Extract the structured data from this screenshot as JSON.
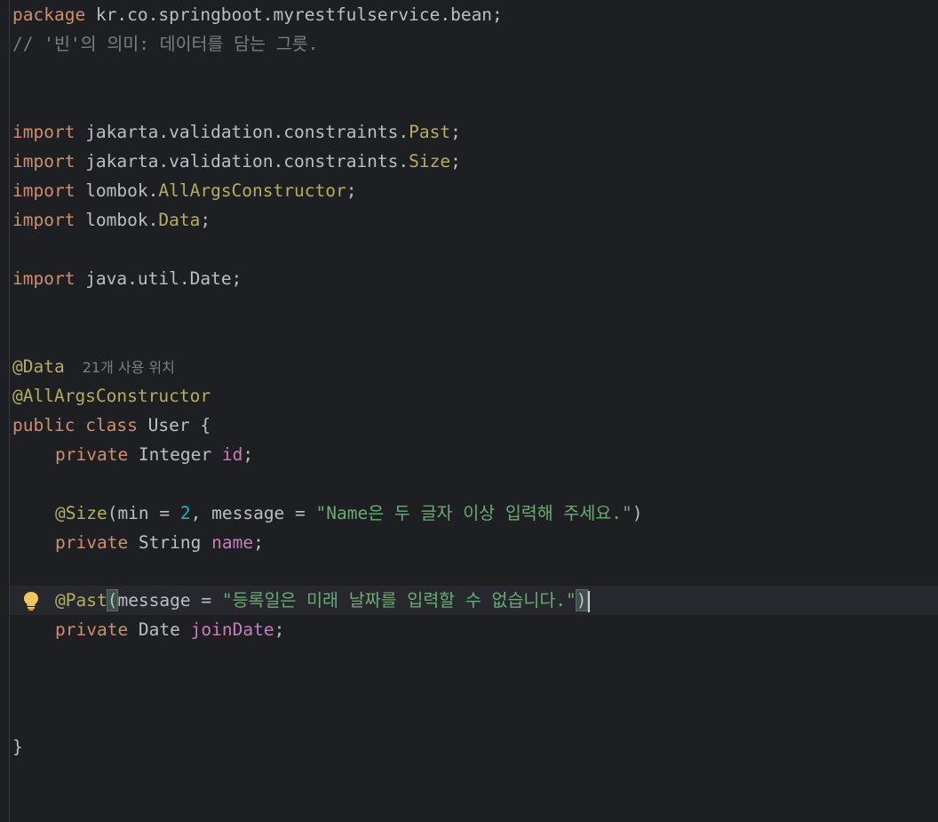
{
  "editor": {
    "language": "java",
    "colors": {
      "background": "#1e1f22",
      "keyword": "#cf8e6d",
      "annotation": "#b3ae60",
      "field": "#c77dbb",
      "string": "#6aab73",
      "number": "#2aacb8",
      "comment": "#7a7e85",
      "text": "#bcbec4"
    },
    "code": {
      "l1_kw": "package",
      "l1_rest": " kr.co.springboot.myrestfulservice.bean;",
      "l2_comment": "// '빈'의 의미: 데이터를 담는 그릇.",
      "import_kw": "import",
      "l5_pkg": " jakarta.validation.constraints.",
      "l5_cls": "Past",
      "l6_pkg": " jakarta.validation.constraints.",
      "l6_cls": "Size",
      "l7_pkg": " lombok.",
      "l7_cls": "AllArgsConstructor",
      "l8_pkg": " lombok.",
      "l8_cls": "Data",
      "semi": ";",
      "l10_rest": " java.util.Date;",
      "l13_ann": "@Data",
      "l13_hint": "21개 사용 위치",
      "l14_ann": "@AllArgsConstructor",
      "public_kw": "public",
      "class_kw": " class",
      "class_name": " User {",
      "private_kw": "private",
      "l16_type": " Integer ",
      "l16_field": "id",
      "l18_ann": "@Size",
      "l18_open": "(min = ",
      "l18_num": "2",
      "l18_mid": ", message = ",
      "l18_str": "\"Name은 두 글자 이상 입력해 주세요.\"",
      "l18_close": ")",
      "l19_type": " String ",
      "l19_field": "name",
      "l21_ann": "@Past",
      "l21_open": "(",
      "l21_mid": "message = ",
      "l21_str": "\"등록일은 미래 날짜를 입력할 수 없습니다.\"",
      "l21_close": ")",
      "l22_type": " Date ",
      "l22_field": "joinDate",
      "close_brace": "}"
    },
    "icons": {
      "intention": "lightbulb-icon"
    }
  }
}
